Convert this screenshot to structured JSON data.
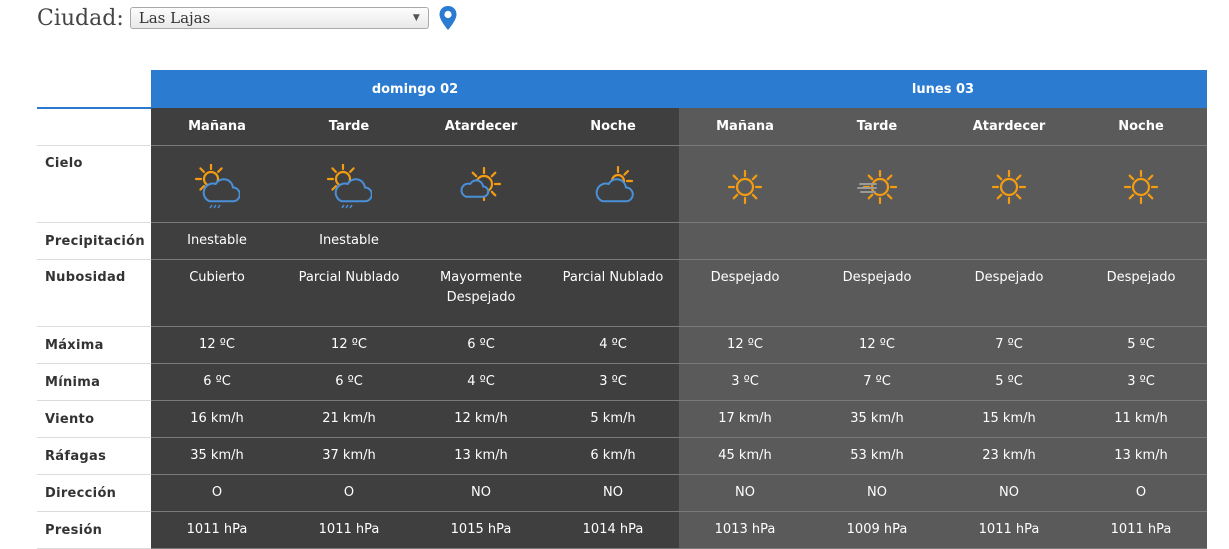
{
  "city": {
    "label": "Ciudad:",
    "selected": "Las Lajas"
  },
  "icons": {
    "pin": "map-pin-icon",
    "select_arrow": "▼"
  },
  "colors": {
    "header_blue": "#2b7bd1",
    "day1_bg": "#3f3f3f",
    "day2_bg": "#5a5a5a",
    "sun": "#f39c12",
    "cloud": "#4a90d9"
  },
  "days": [
    {
      "name": "domingo 02"
    },
    {
      "name": "lunes 03"
    }
  ],
  "periods": [
    "Mañana",
    "Tarde",
    "Atardecer",
    "Noche",
    "Mañana",
    "Tarde",
    "Atardecer",
    "Noche"
  ],
  "labels": {
    "cielo": "Cielo",
    "precipitacion": "Precipitación",
    "nubosidad": "Nubosidad",
    "maxima": "Máxima",
    "minima": "Mínima",
    "viento": "Viento",
    "rafagas": "Ráfagas",
    "direccion": "Dirección",
    "presion": "Presión"
  },
  "sky": [
    "sun-cloud-rain-icon",
    "sun-cloud-rain-icon",
    "sun-cloud-icon",
    "cloud-sun-icon",
    "sun-icon",
    "sun-wind-icon",
    "sun-icon",
    "sun-icon"
  ],
  "precipitacion": [
    "Inestable",
    "Inestable",
    "",
    "",
    "",
    "",
    "",
    ""
  ],
  "nubosidad": [
    [
      "Cubierto"
    ],
    [
      "Parcial Nublado"
    ],
    [
      "Mayormente",
      "Despejado"
    ],
    [
      "Parcial Nublado"
    ],
    [
      "Despejado"
    ],
    [
      "Despejado"
    ],
    [
      "Despejado"
    ],
    [
      "Despejado"
    ]
  ],
  "maxima": [
    "12 ºC",
    "12 ºC",
    "6 ºC",
    "4 ºC",
    "12 ºC",
    "12 ºC",
    "7 ºC",
    "5 ºC"
  ],
  "minima": [
    "6 ºC",
    "6 ºC",
    "4 ºC",
    "3 ºC",
    "3 ºC",
    "7 ºC",
    "5 ºC",
    "3 ºC"
  ],
  "viento": [
    "16 km/h",
    "21 km/h",
    "12 km/h",
    "5 km/h",
    "17 km/h",
    "35 km/h",
    "15 km/h",
    "11 km/h"
  ],
  "rafagas": [
    "35 km/h",
    "37 km/h",
    "13 km/h",
    "6 km/h",
    "45 km/h",
    "53 km/h",
    "23 km/h",
    "13 km/h"
  ],
  "direccion": [
    "O",
    "O",
    "NO",
    "NO",
    "NO",
    "NO",
    "NO",
    "O"
  ],
  "presion": [
    "1011 hPa",
    "1011 hPa",
    "1015 hPa",
    "1014 hPa",
    "1013 hPa",
    "1009 hPa",
    "1011 hPa",
    "1011 hPa"
  ]
}
